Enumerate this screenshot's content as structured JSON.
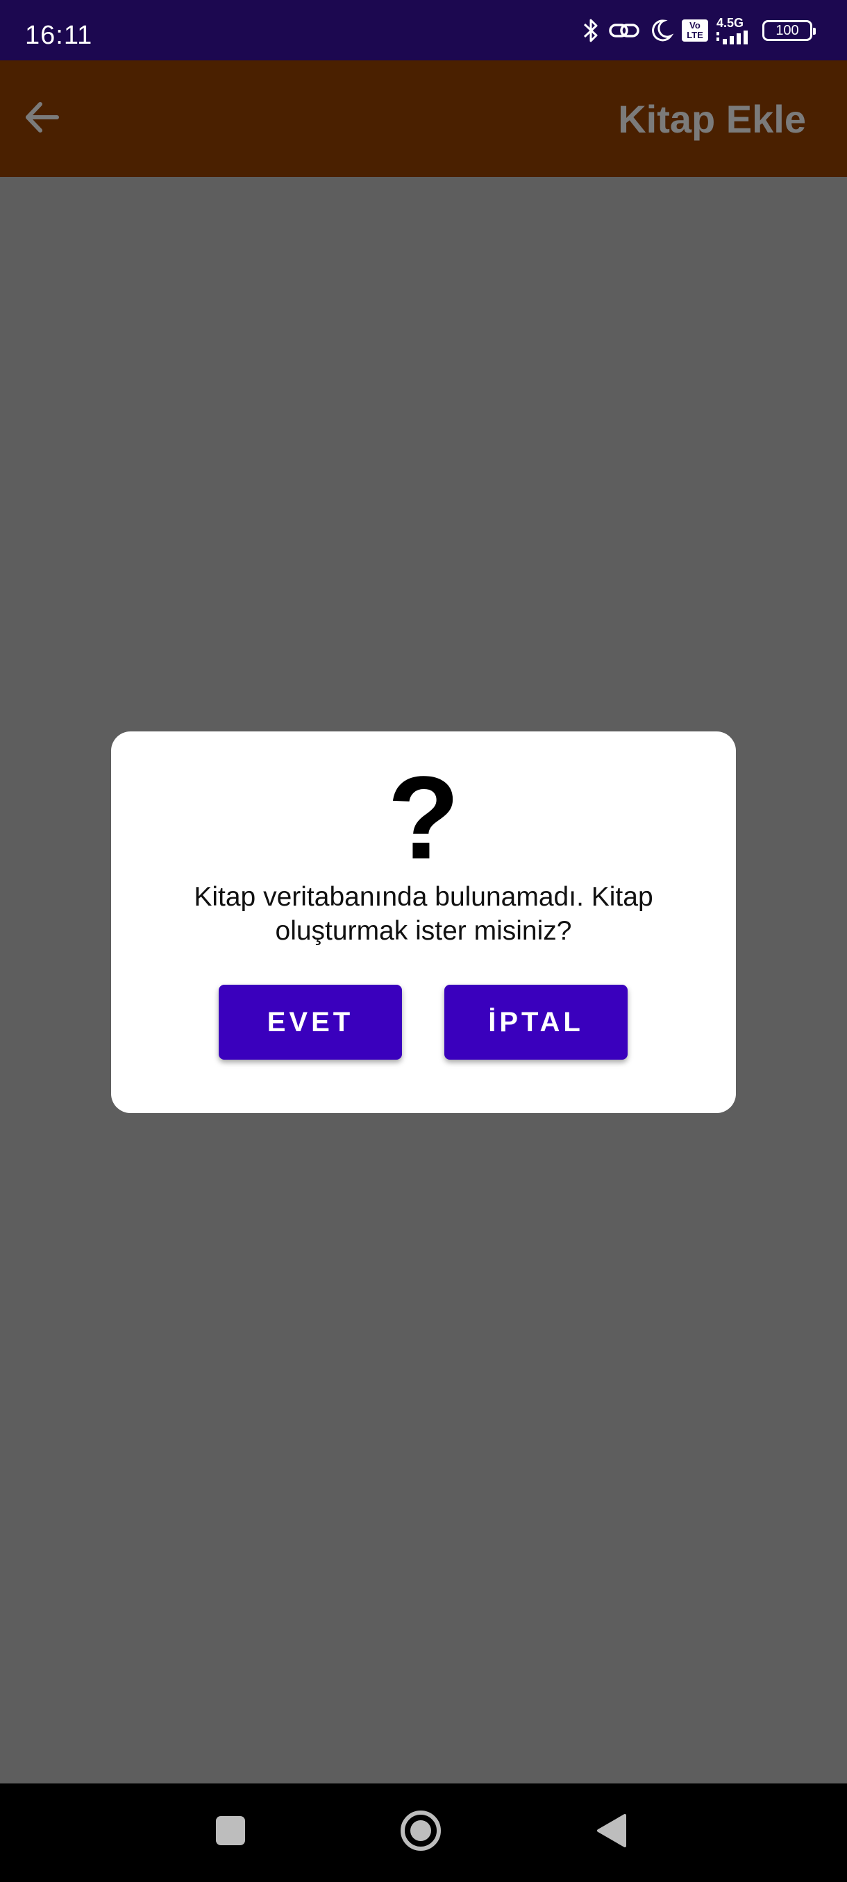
{
  "status_bar": {
    "time": "16:11",
    "lte_top": "Vo",
    "lte_bottom": "LTE",
    "network": "4.5G",
    "battery": "100",
    "icons": [
      "bluetooth-icon",
      "link-icon",
      "moon-icon",
      "volte-icon",
      "signal-icon",
      "battery-icon"
    ]
  },
  "app_bar": {
    "title": "Kitap Ekle",
    "back_icon": "arrow-back-icon"
  },
  "dialog": {
    "icon": "?",
    "message": "Kitap veritabanında bulunamadı. Kitap oluşturmak ister misiniz?",
    "confirm_label": "EVET",
    "cancel_label": "İPTAL"
  },
  "nav_bar": {
    "icons": [
      "recents-icon",
      "home-icon",
      "back-icon"
    ]
  },
  "colors": {
    "status_bar": "#1c0850",
    "app_bar": "#4a2000",
    "scrim_background": "#5e5e5e",
    "button": "#3a00bd",
    "title_text": "#7b7b7b"
  }
}
